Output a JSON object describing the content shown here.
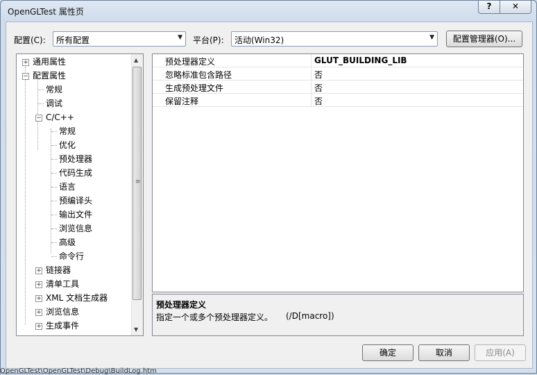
{
  "window": {
    "title": "OpenGLTest 属性页",
    "help_label": "?",
    "close_label": "✕"
  },
  "config": {
    "label": "配置(C):",
    "value": "所有配置"
  },
  "platform": {
    "label": "平台(P):",
    "value": "活动(Win32)"
  },
  "config_manager_label": "配置管理器(O)...",
  "tree": {
    "nodes": [
      {
        "label": "通用属性",
        "expander": "+"
      },
      {
        "label": "配置属性",
        "expander": "−"
      },
      {
        "label": "常规"
      },
      {
        "label": "调试"
      },
      {
        "label": "C/C++",
        "expander": "−"
      },
      {
        "label": "常规"
      },
      {
        "label": "优化"
      },
      {
        "label": "预处理器"
      },
      {
        "label": "代码生成"
      },
      {
        "label": "语言"
      },
      {
        "label": "预编译头"
      },
      {
        "label": "输出文件"
      },
      {
        "label": "浏览信息"
      },
      {
        "label": "高级"
      },
      {
        "label": "命令行"
      },
      {
        "label": "链接器",
        "expander": "+"
      },
      {
        "label": "清单工具",
        "expander": "+"
      },
      {
        "label": "XML 文档生成器",
        "expander": "+"
      },
      {
        "label": "浏览信息",
        "expander": "+"
      },
      {
        "label": "生成事件",
        "expander": "+"
      }
    ]
  },
  "grid": {
    "rows": [
      {
        "key": "预处理器定义",
        "value": "GLUT_BUILDING_LIB"
      },
      {
        "key": "忽略标准包含路径",
        "value": "否"
      },
      {
        "key": "生成预处理文件",
        "value": "否"
      },
      {
        "key": "保留注释",
        "value": "否"
      }
    ]
  },
  "description": {
    "title": "预处理器定义",
    "text": "指定一个或多个预处理器定义。",
    "flag": "(/D[macro])"
  },
  "buttons": {
    "ok": "确定",
    "cancel": "取消",
    "apply": "应用(A)"
  },
  "behind_text": "OpenGLTest\\OpenGLTest\\Debug\\BuildLog.htm"
}
